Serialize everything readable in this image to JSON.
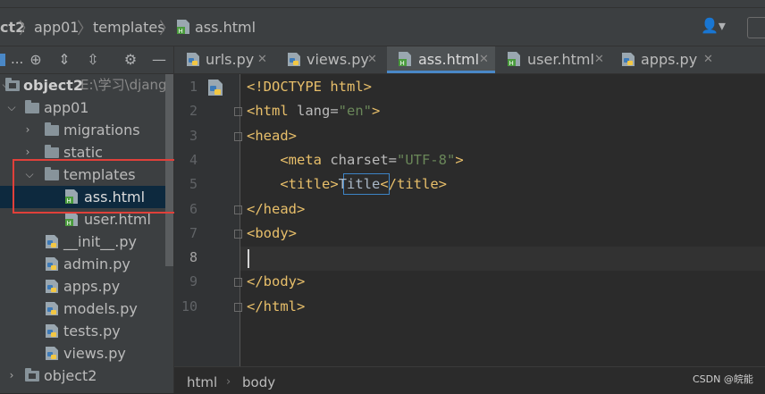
{
  "navbar": {
    "crumbs": [
      "ct2",
      "app01",
      "templates",
      "ass.html"
    ]
  },
  "project_tree": {
    "toolbar_label": "...",
    "items": [
      {
        "label": "object2",
        "hint": "E:\\学习\\django",
        "kind": "module-folder",
        "expanded": true
      },
      {
        "label": "app01",
        "kind": "folder",
        "expanded": true
      },
      {
        "label": "migrations",
        "kind": "folder",
        "expanded": false
      },
      {
        "label": "static",
        "kind": "folder",
        "expanded": false
      },
      {
        "label": "templates",
        "kind": "folder",
        "expanded": true
      },
      {
        "label": "ass.html",
        "kind": "html-file",
        "selected": true
      },
      {
        "label": "user.html",
        "kind": "html-file"
      },
      {
        "label": "__init__.py",
        "kind": "py-file"
      },
      {
        "label": "admin.py",
        "kind": "py-file"
      },
      {
        "label": "apps.py",
        "kind": "py-file"
      },
      {
        "label": "models.py",
        "kind": "py-file"
      },
      {
        "label": "tests.py",
        "kind": "py-file"
      },
      {
        "label": "views.py",
        "kind": "py-file"
      },
      {
        "label": "object2",
        "kind": "module-folder",
        "expanded": false
      }
    ]
  },
  "tabs": [
    {
      "label": "urls.py",
      "kind": "py-file"
    },
    {
      "label": "views.py",
      "kind": "py-file"
    },
    {
      "label": "ass.html",
      "kind": "html-file",
      "active": true
    },
    {
      "label": "user.html",
      "kind": "html-file"
    },
    {
      "label": "apps.py",
      "kind": "py-file"
    }
  ],
  "editor": {
    "current_line": 8,
    "lines": [
      {
        "n": "1",
        "parts": [
          [
            "doctype",
            "<!DOCTYPE html>"
          ]
        ]
      },
      {
        "n": "2",
        "parts": [
          [
            "tag",
            "<html "
          ],
          [
            "attr",
            "lang="
          ],
          [
            "str",
            "\"en\""
          ],
          [
            "tag",
            ">"
          ]
        ]
      },
      {
        "n": "3",
        "parts": [
          [
            "tag",
            "<head>"
          ]
        ]
      },
      {
        "n": "4",
        "parts": [
          [
            "txt",
            "    "
          ],
          [
            "tag",
            "<meta "
          ],
          [
            "attr",
            "charset="
          ],
          [
            "str",
            "\"UTF-8\""
          ],
          [
            "tag",
            ">"
          ]
        ]
      },
      {
        "n": "5",
        "parts": [
          [
            "txt",
            "    "
          ],
          [
            "tag",
            "<title>"
          ],
          [
            "txt",
            "Title"
          ],
          [
            "tag",
            "</title>"
          ]
        ]
      },
      {
        "n": "6",
        "parts": [
          [
            "tag",
            "</head>"
          ]
        ]
      },
      {
        "n": "7",
        "parts": [
          [
            "tag",
            "<body>"
          ]
        ]
      },
      {
        "n": "8",
        "parts": []
      },
      {
        "n": "9",
        "parts": [
          [
            "tag",
            "</body>"
          ]
        ]
      },
      {
        "n": "10",
        "parts": [
          [
            "tag",
            "</html>"
          ]
        ]
      }
    ]
  },
  "statusbar": {
    "crumbs": [
      "html",
      "body"
    ]
  },
  "watermark": "CSDN @皖能",
  "colors": {
    "tag": "#e8bf6a",
    "string": "#6a8759",
    "text": "#a9b7c6",
    "selection_border": "#e0403a",
    "active_tab_underline": "#4a88c7"
  }
}
